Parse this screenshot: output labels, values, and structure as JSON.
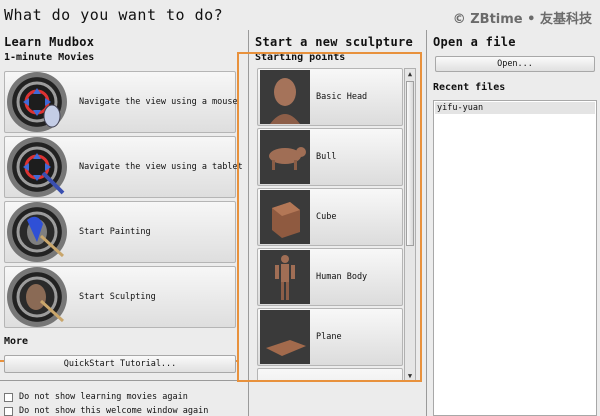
{
  "header": {
    "title": "What do you want to do?",
    "watermark": "© ZBtime • 友基科技"
  },
  "learn": {
    "heading": "Learn Mudbox",
    "subheading": "1-minute Movies",
    "movies": [
      {
        "label": "Navigate the view using a mouse",
        "icon": "mouse-navigate-icon"
      },
      {
        "label": "Navigate the view using a tablet",
        "icon": "tablet-navigate-icon"
      },
      {
        "label": "Start Painting",
        "icon": "painting-icon"
      },
      {
        "label": "Start Sculpting",
        "icon": "sculpting-icon"
      }
    ],
    "more_heading": "More",
    "quickstart_label": "QuickStart Tutorial...",
    "checkbox_learning": "Do not show learning movies again",
    "checkbox_welcome": "Do not show this welcome window again"
  },
  "sculpt": {
    "heading": "Start a new sculpture",
    "subheading": "Starting points",
    "items": [
      {
        "label": "Basic Head",
        "icon": "head-model-icon"
      },
      {
        "label": "Bull",
        "icon": "bull-model-icon"
      },
      {
        "label": "Cube",
        "icon": "cube-model-icon"
      },
      {
        "label": "Human Body",
        "icon": "human-body-model-icon"
      },
      {
        "label": "Plane",
        "icon": "plane-model-icon"
      }
    ]
  },
  "file": {
    "heading": "Open a file",
    "open_label": "Open...",
    "recent_heading": "Recent files",
    "recent": [
      "yifu-yuan"
    ]
  },
  "colors": {
    "highlight": "#e8913c",
    "background": "#ececec"
  }
}
